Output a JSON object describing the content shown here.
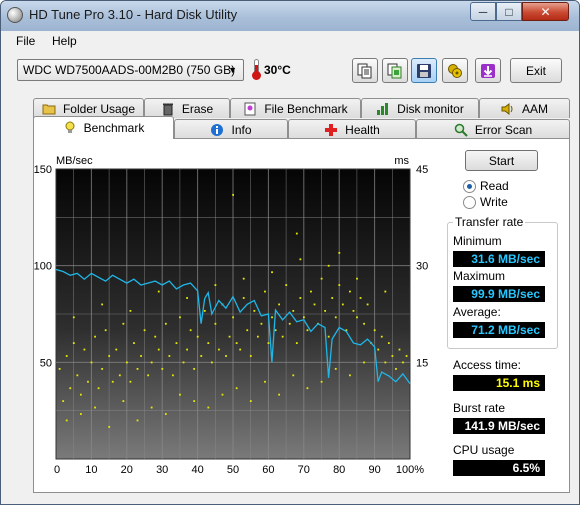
{
  "window": {
    "title": "HD Tune Pro 3.10 - Hard Disk Utility",
    "min": "─",
    "max": "□",
    "close": "✕"
  },
  "menu": {
    "file": "File",
    "help": "Help"
  },
  "toolbar": {
    "drive": "WDC WD7500AADS-00M2B0 (750 GB)",
    "temperature": "30°C",
    "exit_label": "Exit"
  },
  "tabs": {
    "row1": [
      "Folder Usage",
      "Erase",
      "File Benchmark",
      "Disk monitor",
      "AAM"
    ],
    "row2": [
      "Benchmark",
      "Info",
      "Health",
      "Error Scan"
    ],
    "selected": "Benchmark"
  },
  "controls": {
    "start_label": "Start",
    "read_label": "Read",
    "write_label": "Write",
    "selected_mode": "Read"
  },
  "stats": {
    "transfer_rate_title": "Transfer rate",
    "minimum_label": "Minimum",
    "minimum_value": "31.6 MB/sec",
    "maximum_label": "Maximum",
    "maximum_value": "99.9 MB/sec",
    "average_label": "Average:",
    "average_value": "71.2 MB/sec",
    "access_label": "Access time:",
    "access_value": "15.1 ms",
    "burst_label": "Burst rate",
    "burst_value": "141.9 MB/sec",
    "cpu_label": "CPU usage",
    "cpu_value": "6.5%"
  },
  "colors": {
    "transfer_line": "#1fb6e8",
    "access_dots": "#e8e800",
    "value_cyan": "#27c7ff",
    "value_yellow": "#ffff00"
  },
  "chart_data": {
    "type": "line",
    "left_unit": "MB/sec",
    "right_unit": "ms",
    "y_ticks": [
      "150",
      "100",
      "50"
    ],
    "y2_ticks": [
      "45",
      "30",
      "15"
    ],
    "x_ticks": [
      "0",
      "10",
      "20",
      "30",
      "40",
      "50",
      "60",
      "70",
      "80",
      "90",
      "100%"
    ],
    "ylim": [
      0,
      150
    ],
    "y2lim": [
      0,
      45
    ],
    "xlim": [
      0,
      100
    ],
    "transfer_series": {
      "name": "Transfer rate",
      "x": [
        0,
        2,
        4,
        6,
        8,
        10,
        12,
        14,
        16,
        18,
        20,
        22,
        24,
        26,
        28,
        30,
        32,
        34,
        36,
        38,
        40,
        41,
        42,
        43,
        44,
        46,
        48,
        50,
        52,
        54,
        56,
        58,
        60,
        61,
        62,
        64,
        66,
        68,
        70,
        72,
        74,
        76,
        77,
        78,
        80,
        82,
        84,
        86,
        88,
        90,
        91,
        92,
        94,
        96,
        98,
        100
      ],
      "y": [
        98,
        97,
        95,
        96,
        93,
        96,
        94,
        92,
        95,
        93,
        91,
        93,
        90,
        91,
        92,
        90,
        92,
        88,
        90,
        91,
        87,
        70,
        83,
        86,
        75,
        82,
        78,
        84,
        76,
        80,
        82,
        74,
        75,
        50,
        77,
        72,
        76,
        71,
        72,
        66,
        70,
        68,
        42,
        62,
        68,
        66,
        60,
        59,
        62,
        58,
        40,
        45,
        43,
        40,
        44,
        39
      ]
    },
    "access_series": {
      "name": "Access time",
      "x": [
        1,
        2,
        3,
        4,
        5,
        6,
        7,
        8,
        9,
        10,
        11,
        12,
        13,
        14,
        15,
        16,
        17,
        18,
        19,
        20,
        21,
        22,
        23,
        24,
        25,
        26,
        27,
        28,
        29,
        30,
        31,
        32,
        33,
        34,
        35,
        36,
        37,
        38,
        39,
        40,
        41,
        42,
        43,
        44,
        45,
        46,
        47,
        48,
        49,
        50,
        51,
        52,
        53,
        54,
        55,
        56,
        57,
        58,
        59,
        60,
        61,
        62,
        63,
        64,
        65,
        66,
        67,
        68,
        69,
        70,
        71,
        72,
        73,
        74,
        75,
        76,
        77,
        78,
        79,
        80,
        81,
        82,
        83,
        84,
        85,
        86,
        87,
        88,
        89,
        90,
        91,
        92,
        93,
        94,
        95,
        96,
        97,
        98,
        99,
        3,
        7,
        11,
        15,
        19,
        23,
        27,
        31,
        35,
        39,
        43,
        47,
        51,
        55,
        59,
        63,
        67,
        71,
        75,
        79,
        83,
        87,
        5,
        13,
        21,
        29,
        37,
        45,
        53,
        61,
        69,
        77,
        85,
        93,
        50,
        68,
        80
      ],
      "y": [
        14,
        9,
        16,
        11,
        18,
        13,
        10,
        17,
        12,
        15,
        19,
        11,
        14,
        20,
        16,
        12,
        17,
        13,
        21,
        15,
        12,
        18,
        14,
        16,
        20,
        13,
        15,
        19,
        17,
        14,
        21,
        16,
        13,
        18,
        22,
        15,
        17,
        20,
        14,
        19,
        16,
        23,
        18,
        15,
        21,
        17,
        24,
        16,
        19,
        22,
        18,
        17,
        25,
        20,
        16,
        23,
        19,
        21,
        26,
        18,
        22,
        20,
        24,
        19,
        27,
        21,
        23,
        18,
        25,
        22,
        20,
        26,
        24,
        21,
        28,
        23,
        19,
        25,
        22,
        27,
        24,
        20,
        26,
        23,
        22,
        25,
        21,
        24,
        18,
        20,
        17,
        19,
        15,
        18,
        16,
        14,
        17,
        15,
        16,
        6,
        7,
        8,
        5,
        9,
        6,
        8,
        7,
        10,
        9,
        8,
        10,
        11,
        9,
        12,
        10,
        13,
        11,
        12,
        14,
        13,
        15,
        22,
        24,
        23,
        26,
        25,
        27,
        28,
        29,
        31,
        30,
        28,
        26,
        41,
        35,
        32
      ]
    }
  }
}
